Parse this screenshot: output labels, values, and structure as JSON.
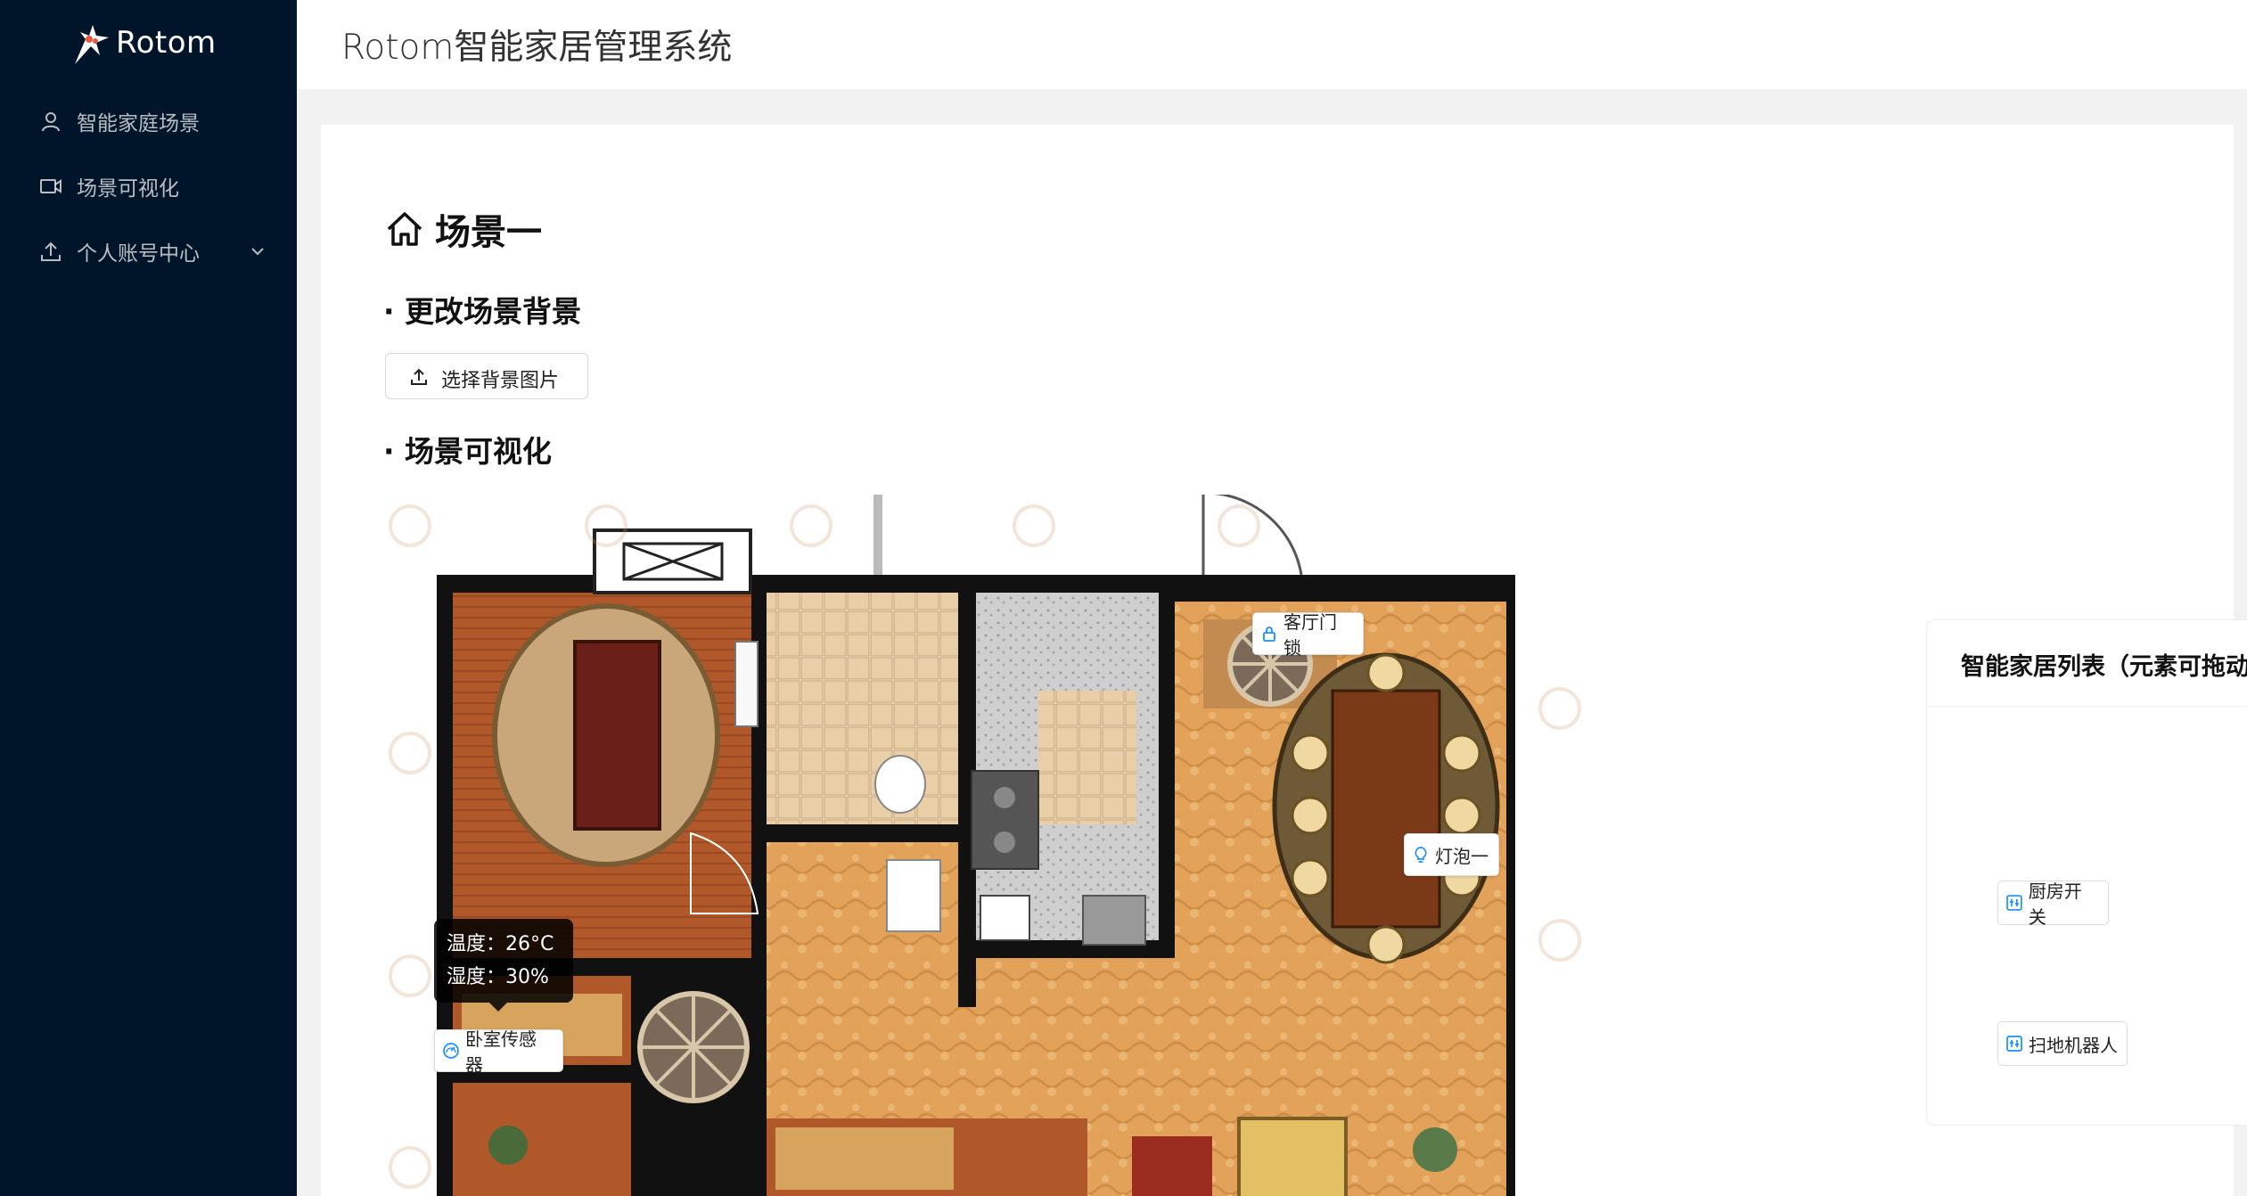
{
  "app": {
    "logo_text": "Rotom",
    "title": "Rotom智能家居管理系统"
  },
  "sidebar": {
    "items": [
      {
        "label": "智能家庭场景",
        "icon": "user-icon"
      },
      {
        "label": "场景可视化",
        "icon": "video-camera-icon"
      },
      {
        "label": "个人账号中心",
        "icon": "upload-icon",
        "has_submenu": true
      }
    ]
  },
  "page": {
    "title": "场景一",
    "section_background": "· 更改场景背景",
    "upload_button": "选择背景图片",
    "section_visual": "· 场景可视化"
  },
  "scene": {
    "devices": [
      {
        "label": "客厅门锁",
        "icon": "lock-icon"
      },
      {
        "label": "灯泡一",
        "icon": "bulb-icon"
      },
      {
        "label": "卧室传感器",
        "icon": "dashboard-icon"
      }
    ],
    "tooltip": {
      "temp": "温度：26°C",
      "humidity": "湿度：30%"
    }
  },
  "device_panel": {
    "title": "智能家居列表（元素可拖动）",
    "items": [
      {
        "label": "厨房开关",
        "icon": "switch-icon"
      },
      {
        "label": "扫地机器人",
        "icon": "robot-icon"
      }
    ]
  },
  "colors": {
    "sidebar_bg": "#001529",
    "accent": "#1890ff",
    "page_bg": "#f2f2f2"
  }
}
